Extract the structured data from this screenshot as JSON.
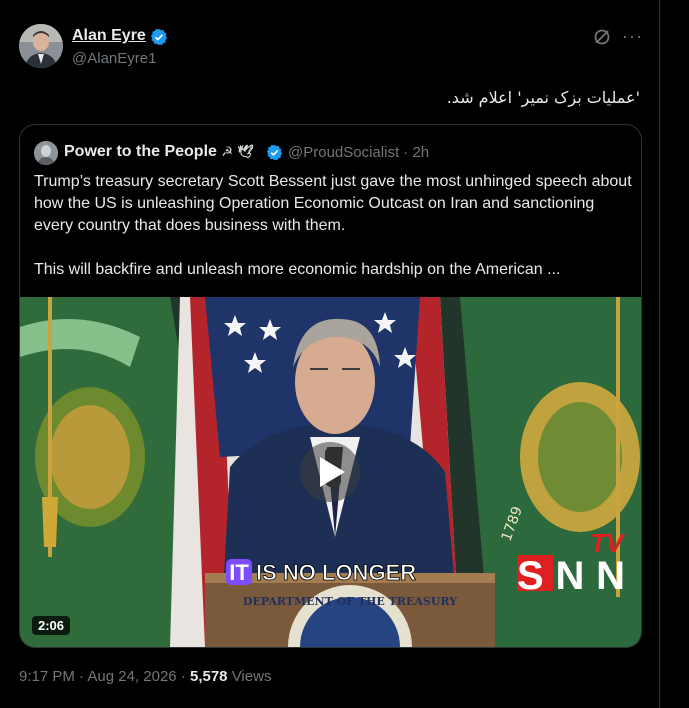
{
  "author": {
    "name": "Alan Eyre",
    "handle": "@AlanEyre1"
  },
  "tweet": {
    "text": "'عملیات بزک نمیر' اعلام شد."
  },
  "quoted": {
    "name": "Power to the People",
    "name_emoji": "☭ 🕊",
    "handle": "@ProudSocialist",
    "separator": "·",
    "age": "2h",
    "paragraphs": [
      "Trump’s treasury secretary Scott Bessent just gave the most unhinged speech about how the US is unleashing Operation Economic Outcast on Iran and sanctioning every country that does business with them.",
      "This will backfire and unleash more economic hardship on the American ..."
    ],
    "video": {
      "duration": "2:06",
      "caption_prefix": "IT",
      "caption": "IS NO LONGER",
      "channel_logo": "SNN",
      "channel_logo_tv": "TV",
      "seal_text": "DEPARTMENT OF THE TREASURY",
      "flag_year": "1789"
    }
  },
  "footer": {
    "time": "9:17 PM",
    "date": "Aug 24, 2026",
    "views_count": "5,578",
    "views_label": "Views",
    "separator": "·"
  },
  "colors": {
    "background": "#000000",
    "text": "#e7e9ea",
    "muted": "#71767b",
    "border": "#2f3336",
    "verified": "#1d9bf0"
  },
  "icons": [
    "verified-badge-icon",
    "grok-icon",
    "more-icon",
    "play-icon"
  ]
}
